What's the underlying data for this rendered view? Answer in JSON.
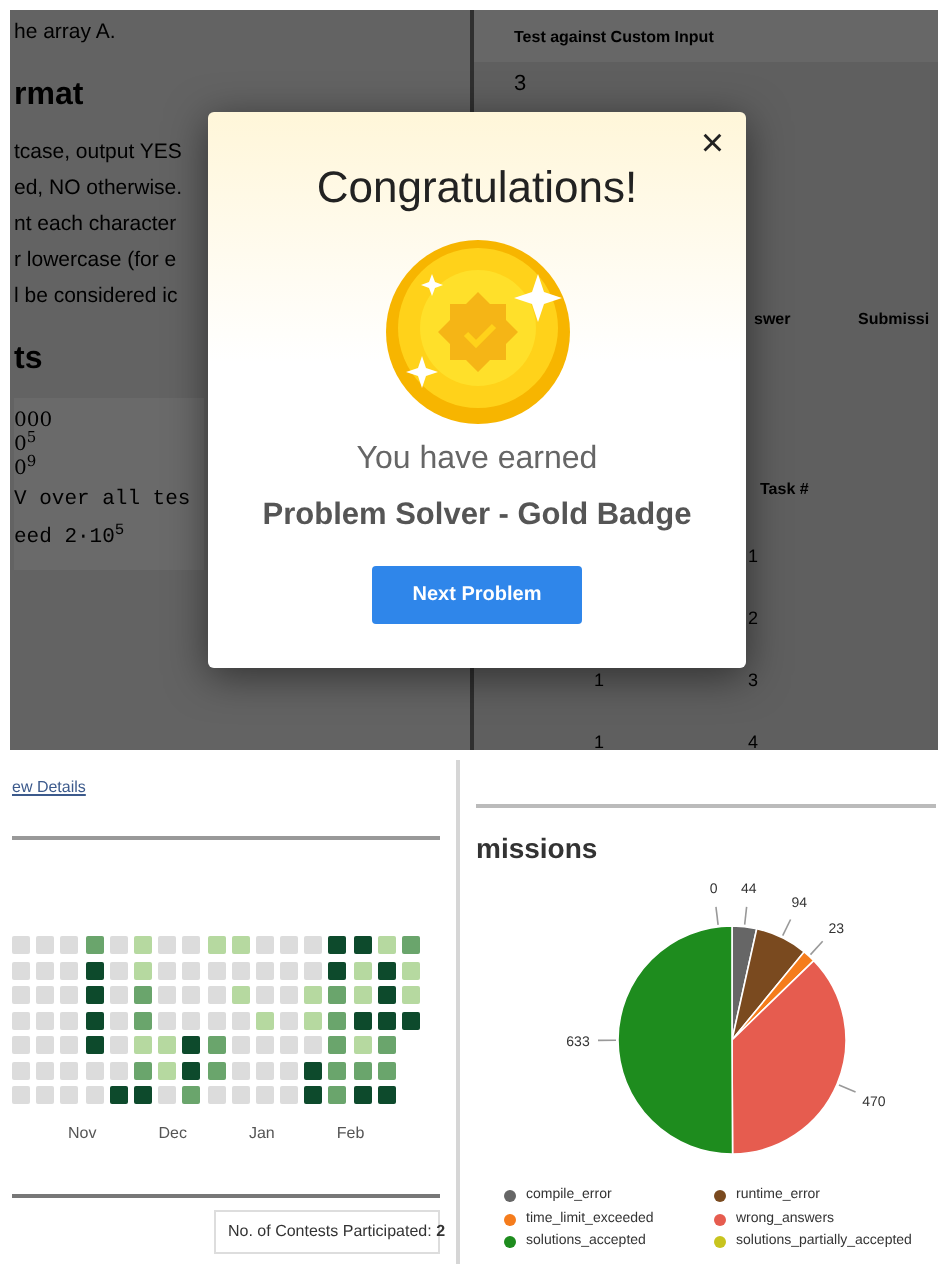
{
  "problem_statement": {
    "lines": [
      {
        "kind": "text",
        "text": "he array A."
      },
      {
        "kind": "heading",
        "text": "rmat"
      },
      {
        "kind": "text",
        "text": "tcase, output YES"
      },
      {
        "kind": "text",
        "text": "ed, NO otherwise."
      },
      {
        "kind": "text",
        "text": "nt each character"
      },
      {
        "kind": "text",
        "text": "r lowercase (for e"
      },
      {
        "kind": "text",
        "text": "l be considered ic"
      },
      {
        "kind": "heading",
        "text": "ts"
      },
      {
        "kind": "math",
        "text": "000"
      },
      {
        "kind": "math",
        "text": "0$^{5}$"
      },
      {
        "kind": "math",
        "text": "0$^{9}$"
      },
      {
        "kind": "code",
        "text": "V over all tes"
      },
      {
        "kind": "code",
        "text": "eed 2·10$^{5}$"
      }
    ]
  },
  "custom_input": {
    "title": "Test against Custom Input",
    "value": "3"
  },
  "results_table": {
    "columns": [
      "swer",
      "Submissi"
    ],
    "task_header": "Task #",
    "rows": [
      {
        "column_1": "",
        "task": "1"
      },
      {
        "column_1": "",
        "task": "2"
      },
      {
        "column_1": "1",
        "task": "3"
      },
      {
        "column_1": "1",
        "task": "4"
      }
    ]
  },
  "modal": {
    "title": "Congratulations!",
    "message": "You have earned",
    "badge": "Problem Solver - Gold Badge",
    "button": "Next Problem",
    "close": "×"
  },
  "activity": {
    "link": "ew Details",
    "months": [
      "Nov",
      "Dec",
      "Jan",
      "Feb"
    ],
    "rows": [
      {
        "cells": [
          {
            "color": "#dcdcdc"
          },
          {
            "color": "#dcdcdc"
          },
          {
            "color": "#dcdcdc"
          },
          {
            "color": "#6aa56c"
          },
          {
            "color": "#dcdcdc"
          },
          {
            "color": "#b6d9a0"
          },
          {
            "color": "#dcdcdc"
          },
          {
            "color": "#dcdcdc"
          },
          {
            "color": "#b6d9a0"
          },
          {
            "color": "#b6d9a0"
          },
          {
            "color": "#dcdcdc"
          },
          {
            "color": "#dcdcdc"
          },
          {
            "color": "#dcdcdc"
          },
          {
            "color": "#0d4a2c"
          },
          {
            "color": "#0d4a2c"
          },
          {
            "color": "#b6d9a0"
          },
          {
            "color": "#6aa56c"
          }
        ]
      },
      {
        "cells": [
          {
            "color": "#dcdcdc"
          },
          {
            "color": "#dcdcdc"
          },
          {
            "color": "#dcdcdc"
          },
          {
            "color": "#0d4a2c"
          },
          {
            "color": "#dcdcdc"
          },
          {
            "color": "#b6d9a0"
          },
          {
            "color": "#dcdcdc"
          },
          {
            "color": "#dcdcdc"
          },
          {
            "color": "#dcdcdc"
          },
          {
            "color": "#dcdcdc"
          },
          {
            "color": "#dcdcdc"
          },
          {
            "color": "#dcdcdc"
          },
          {
            "color": "#dcdcdc"
          },
          {
            "color": "#0d4a2c"
          },
          {
            "color": "#b6d9a0"
          },
          {
            "color": "#0d4a2c"
          },
          {
            "color": "#b6d9a0"
          }
        ]
      },
      {
        "cells": [
          {
            "color": "#dcdcdc"
          },
          {
            "color": "#dcdcdc"
          },
          {
            "color": "#dcdcdc"
          },
          {
            "color": "#0d4a2c"
          },
          {
            "color": "#dcdcdc"
          },
          {
            "color": "#6aa56c"
          },
          {
            "color": "#dcdcdc"
          },
          {
            "color": "#dcdcdc"
          },
          {
            "color": "#dcdcdc"
          },
          {
            "color": "#b6d9a0"
          },
          {
            "color": "#dcdcdc"
          },
          {
            "color": "#dcdcdc"
          },
          {
            "color": "#b6d9a0"
          },
          {
            "color": "#6aa56c"
          },
          {
            "color": "#b6d9a0"
          },
          {
            "color": "#0d4a2c"
          },
          {
            "color": "#b6d9a0"
          }
        ]
      },
      {
        "cells": [
          {
            "color": "#dcdcdc"
          },
          {
            "color": "#dcdcdc"
          },
          {
            "color": "#dcdcdc"
          },
          {
            "color": "#0d4a2c"
          },
          {
            "color": "#dcdcdc"
          },
          {
            "color": "#6aa56c"
          },
          {
            "color": "#dcdcdc"
          },
          {
            "color": "#dcdcdc"
          },
          {
            "color": "#dcdcdc"
          },
          {
            "color": "#dcdcdc"
          },
          {
            "color": "#b6d9a0"
          },
          {
            "color": "#dcdcdc"
          },
          {
            "color": "#b6d9a0"
          },
          {
            "color": "#6aa56c"
          },
          {
            "color": "#0d4a2c"
          },
          {
            "color": "#0d4a2c"
          },
          {
            "color": "#0d4a2c"
          }
        ]
      },
      {
        "cells": [
          {
            "color": "#dcdcdc"
          },
          {
            "color": "#dcdcdc"
          },
          {
            "color": "#dcdcdc"
          },
          {
            "color": "#0d4a2c"
          },
          {
            "color": "#dcdcdc"
          },
          {
            "color": "#b6d9a0"
          },
          {
            "color": "#b6d9a0"
          },
          {
            "color": "#0d4a2c"
          },
          {
            "color": "#6aa56c"
          },
          {
            "color": "#dcdcdc"
          },
          {
            "color": "#dcdcdc"
          },
          {
            "color": "#dcdcdc"
          },
          {
            "color": "#dcdcdc"
          },
          {
            "color": "#6aa56c"
          },
          {
            "color": "#b6d9a0"
          },
          {
            "color": "#6aa56c"
          }
        ]
      },
      {
        "cells": [
          {
            "color": "#dcdcdc"
          },
          {
            "color": "#dcdcdc"
          },
          {
            "color": "#dcdcdc"
          },
          {
            "color": "#dcdcdc"
          },
          {
            "color": "#dcdcdc"
          },
          {
            "color": "#6aa56c"
          },
          {
            "color": "#b6d9a0"
          },
          {
            "color": "#0d4a2c"
          },
          {
            "color": "#6aa56c"
          },
          {
            "color": "#dcdcdc"
          },
          {
            "color": "#dcdcdc"
          },
          {
            "color": "#dcdcdc"
          },
          {
            "color": "#0d4a2c"
          },
          {
            "color": "#6aa56c"
          },
          {
            "color": "#6aa56c"
          },
          {
            "color": "#6aa56c"
          }
        ]
      },
      {
        "cells": [
          {
            "color": "#dcdcdc"
          },
          {
            "color": "#dcdcdc"
          },
          {
            "color": "#dcdcdc"
          },
          {
            "color": "#dcdcdc"
          },
          {
            "color": "#0d4a2c"
          },
          {
            "color": "#0d4a2c"
          },
          {
            "color": "#dcdcdc"
          },
          {
            "color": "#6aa56c"
          },
          {
            "color": "#dcdcdc"
          },
          {
            "color": "#dcdcdc"
          },
          {
            "color": "#dcdcdc"
          },
          {
            "color": "#dcdcdc"
          },
          {
            "color": "#0d4a2c"
          },
          {
            "color": "#6aa56c"
          },
          {
            "color": "#0d4a2c"
          },
          {
            "color": "#0d4a2c"
          }
        ]
      }
    ],
    "contests": "No. of Contests Participated: **2**"
  },
  "submissions": {
    "title": "missions",
    "chart_data": {
      "type": "pie",
      "data_labels": true,
      "categories": [
        "compile_error",
        "runtime_error",
        "time_limit_exceeded",
        "wrong_answers",
        "solutions_accepted",
        "solutions_partially_accepted"
      ],
      "values": [
        44,
        94,
        23,
        470,
        633,
        0
      ],
      "colors": [
        "#666666",
        "#7a4a1f",
        "#f57c1c",
        "#e65c4f",
        "#1e8c1e",
        "#c8c41e"
      ],
      "value_labels": [
        "44",
        "94",
        "23",
        "470",
        "633",
        "0"
      ]
    }
  }
}
